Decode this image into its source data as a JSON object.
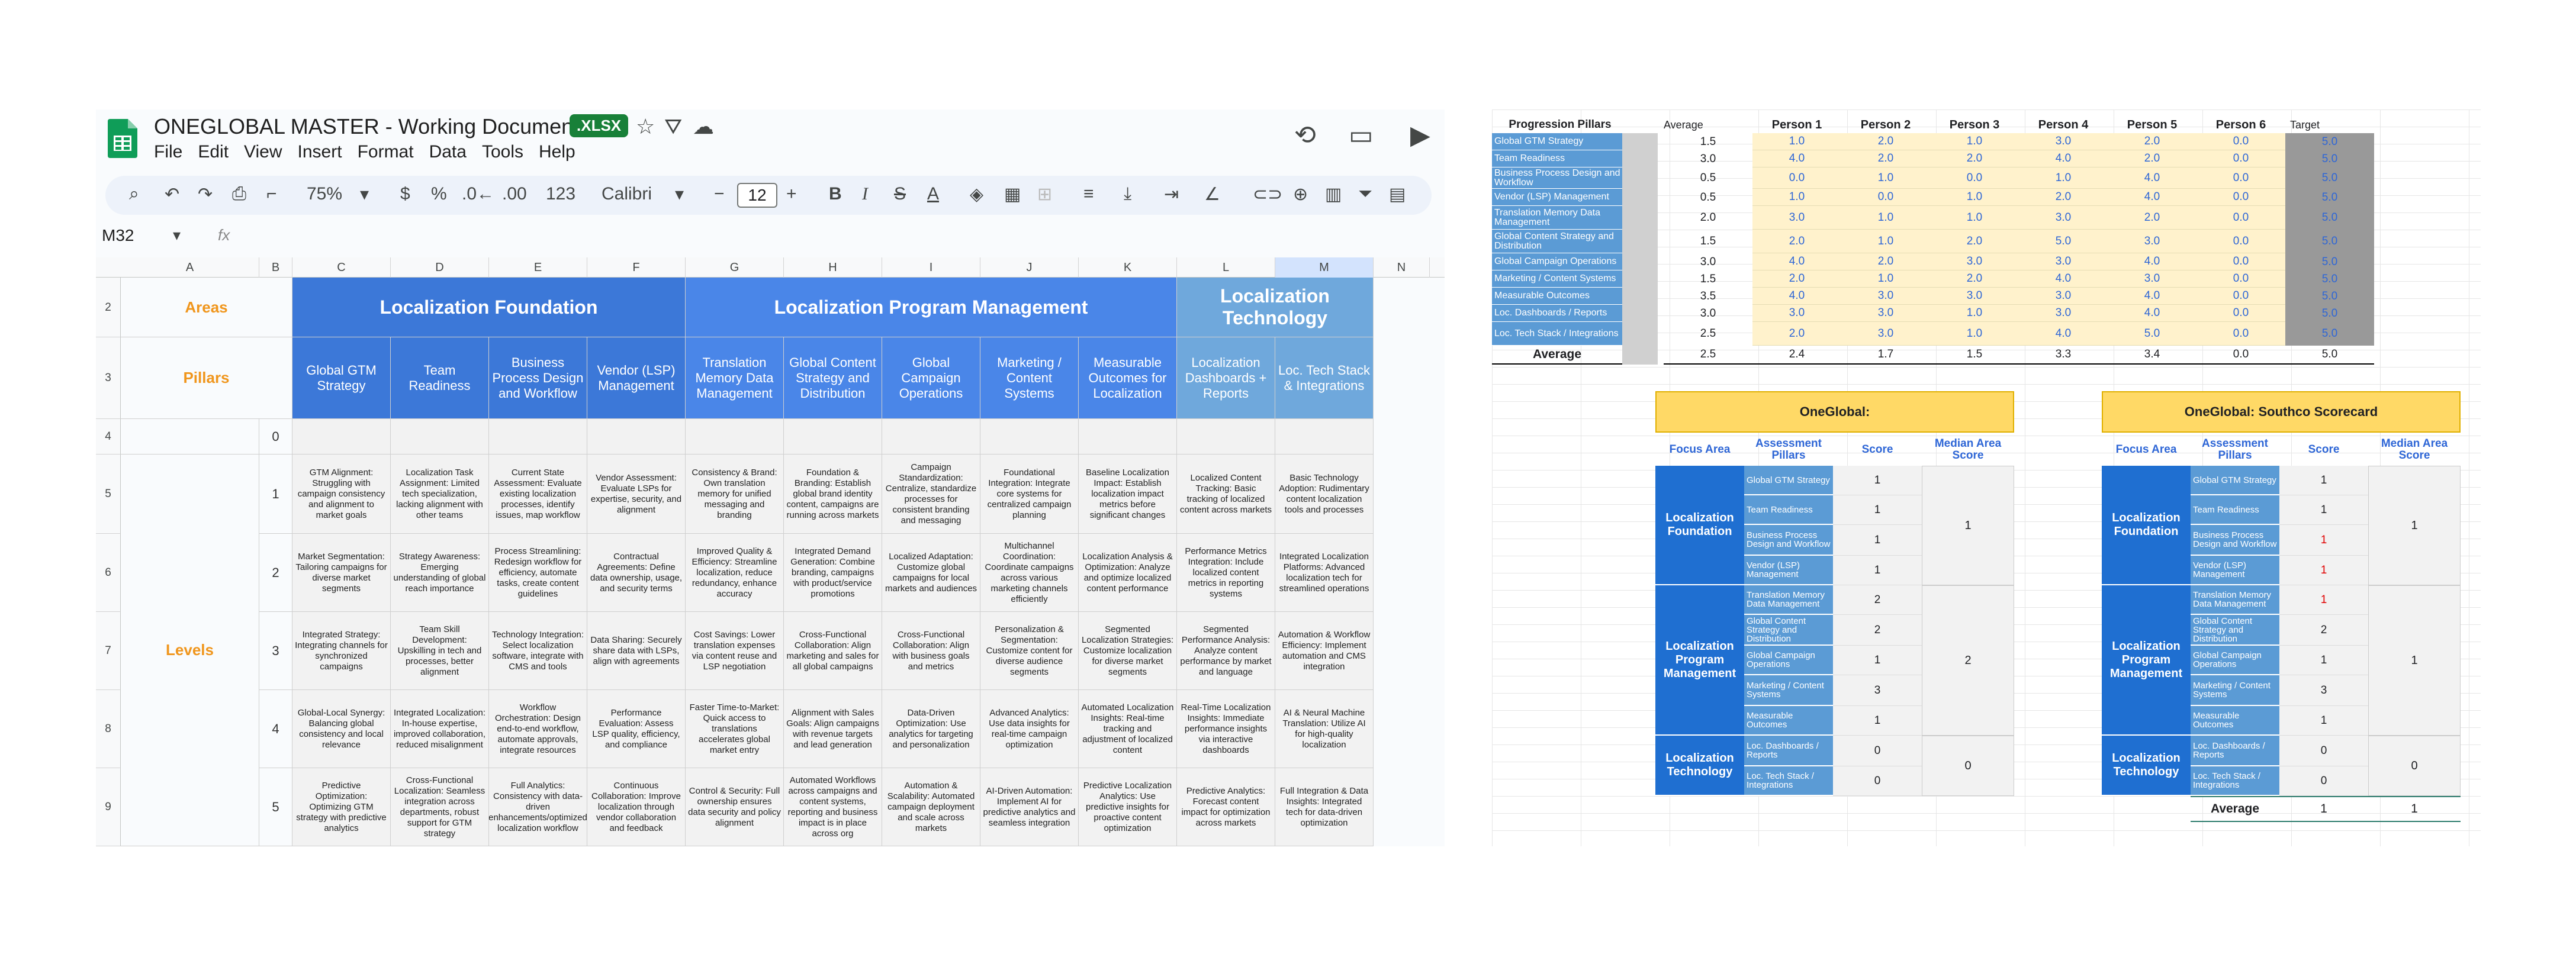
{
  "sheet": {
    "title": "ONEGLOBAL MASTER - Working Documents",
    "badge": ".XLSX",
    "menu": [
      "File",
      "Edit",
      "View",
      "Insert",
      "Format",
      "Data",
      "Tools",
      "Help"
    ],
    "zoom": "75%",
    "currency": "$",
    "percent": "%",
    "dec_less": ".0←",
    "dec_more": ".00",
    "num_fmt": "123",
    "font": "Calibri",
    "font_size": "12",
    "cell_ref": "M32",
    "fx": "fx",
    "columns": [
      "A",
      "B",
      "C",
      "D",
      "E",
      "F",
      "G",
      "H",
      "I",
      "J",
      "K",
      "L",
      "M",
      "N"
    ],
    "rows": [
      "2",
      "3",
      "4",
      "5",
      "6",
      "7",
      "8",
      "9"
    ],
    "areas_label": "Areas",
    "pillars_label": "Pillars",
    "levels_label": "Levels",
    "zero": "0",
    "groups": [
      "Localization Foundation",
      "Localization Program Management",
      "Localization Technology"
    ],
    "pillars": [
      "Global GTM Strategy",
      "Team Readiness",
      "Business Process Design and Workflow",
      "Vendor (LSP) Management",
      "Translation Memory Data Management",
      "Global Content Strategy and Distribution",
      "Global Campaign Operations",
      "Marketing / Content Systems",
      "Measurable Outcomes for Localization",
      "Localization Dashboards + Reports",
      "Loc. Tech Stack & Integrations"
    ],
    "levels": [
      {
        "n": "1",
        "cells": [
          "GTM Alignment: Struggling with campaign consistency and alignment to market goals",
          "Localization Task Assignment: Limited tech specialization, lacking alignment with other teams",
          "Current State Assessment: Evaluate existing localization processes, identify issues, map workflow",
          "Vendor Assessment: Evaluate LSPs for expertise, security, and alignment",
          "Consistency & Brand: Own translation memory for unified messaging and branding",
          "Foundation & Branding: Establish global brand identity content, campaigns are running across markets",
          "Campaign Standardization: Centralize, standardize processes for consistent branding and messaging",
          "Foundational Integration: Integrate core systems for centralized campaign planning",
          "Baseline Localization Impact: Establish localization impact metrics before significant changes",
          "Localized Content Tracking: Basic tracking of localized content across markets",
          "Basic Technology Adoption: Rudimentary content localization tools and processes"
        ]
      },
      {
        "n": "2",
        "cells": [
          "Market Segmentation: Tailoring campaigns for diverse market segments",
          "Strategy Awareness: Emerging understanding of global reach importance",
          "Process Streamlining: Redesign workflow for efficiency, automate tasks, create content guidelines",
          "Contractual Agreements: Define data ownership, usage, and security terms",
          "Improved Quality & Efficiency: Streamline localization, reduce redundancy, enhance accuracy",
          "Integrated Demand Generation: Combine branding, campaigns with product/service promotions",
          "Localized Adaptation: Customize global campaigns for local markets and audiences",
          "Multichannel Coordination: Coordinate campaigns across various marketing channels efficiently",
          "Localization Analysis & Optimization: Analyze and optimize localized content performance",
          "Performance Metrics Integration: Include localized content metrics in reporting systems",
          "Integrated Localization Platforms: Advanced localization tech for streamlined operations"
        ]
      },
      {
        "n": "3",
        "cells": [
          "Integrated Strategy: Integrating channels for synchronized campaigns",
          "Team Skill Development: Upskilling in tech and processes, better alignment",
          "Technology Integration: Select localization software, integrate with CMS and tools",
          "Data Sharing: Securely share data with LSPs, align with agreements",
          "Cost Savings: Lower translation expenses via content reuse and LSP negotiation",
          "Cross-Functional Collaboration: Align marketing and sales for all global campaigns",
          "Cross-Functional Collaboration: Align with business goals and metrics",
          "Personalization & Segmentation: Customize content for diverse audience segments",
          "Segmented Localization Strategies: Customize localization for diverse market segments",
          "Segmented Performance Analysis: Analyze content performance by market and language",
          "Automation & Workflow Efficiency: Implement automation and CMS integration"
        ]
      },
      {
        "n": "4",
        "cells": [
          "Global-Local Synergy: Balancing global consistency and local relevance",
          "Integrated Localization: In-house expertise, improved collaboration, reduced misalignment",
          "Workflow Orchestration: Design end-to-end workflow, automate approvals, integrate resources",
          "Performance Evaluation: Assess LSP quality, efficiency, and compliance",
          "Faster Time-to-Market: Quick access to translations accelerates global market entry",
          "Alignment with Sales Goals: Align campaigns with revenue targets and lead generation",
          "Data-Driven Optimization: Use analytics for targeting and personalization",
          "Advanced Analytics: Use data insights for real-time campaign optimization",
          "Automated Localization Insights: Real-time tracking and adjustment of localized content",
          "Real-Time Localization Insights: Immediate performance insights via interactive dashboards",
          "AI & Neural Machine Translation: Utilize AI for high-quality localization"
        ]
      },
      {
        "n": "5",
        "cells": [
          "Predictive Optimization: Optimizing GTM strategy with predictive analytics",
          "Cross-Functional Localization: Seamless integration across departments, robust support for GTM strategy",
          "Full Analytics: Consistency with data-driven enhancements/optimized localization workflow",
          "Continuous Collaboration: Improve localization through vendor collaboration and feedback",
          "Control & Security: Full ownership ensures data security and policy alignment",
          "Automated Workflows across campaigns and content systems, reporting and business impact is in place across org",
          "Automation & Scalability: Automated campaign deployment and scale across markets",
          "AI-Driven Automation: Implement AI for predictive analytics and seamless integration",
          "Predictive Localization Analytics: Use predictive insights for proactive content optimization",
          "Predictive Analytics: Forecast content impact for optimization across markets",
          "Full Integration & Data Insights: Integrated tech for data-driven optimization"
        ]
      }
    ]
  },
  "progress": {
    "header_pillars": "Progression Pillars",
    "header_average": "Average",
    "persons": [
      "Person 1",
      "Person 2",
      "Person 3",
      "Person 4",
      "Person 5",
      "Person 6"
    ],
    "target_label": "Target",
    "rows": [
      {
        "p": "Global GTM Strategy",
        "avg": "1.5",
        "v": [
          "1.0",
          "2.0",
          "1.0",
          "3.0",
          "2.0",
          "0.0"
        ],
        "t": "5.0"
      },
      {
        "p": "Team Readiness",
        "avg": "3.0",
        "v": [
          "4.0",
          "2.0",
          "2.0",
          "4.0",
          "2.0",
          "0.0"
        ],
        "t": "5.0"
      },
      {
        "p": "Business Process Design and Workflow",
        "avg": "0.5",
        "v": [
          "0.0",
          "1.0",
          "0.0",
          "1.0",
          "4.0",
          "0.0"
        ],
        "t": "5.0"
      },
      {
        "p": "Vendor (LSP) Management",
        "avg": "0.5",
        "v": [
          "1.0",
          "0.0",
          "1.0",
          "2.0",
          "4.0",
          "0.0"
        ],
        "t": "5.0"
      },
      {
        "p": "Translation Memory Data Management",
        "avg": "2.0",
        "v": [
          "3.0",
          "1.0",
          "1.0",
          "3.0",
          "2.0",
          "0.0"
        ],
        "t": "5.0"
      },
      {
        "p": "Global Content Strategy and Distribution",
        "avg": "1.5",
        "v": [
          "2.0",
          "1.0",
          "2.0",
          "5.0",
          "3.0",
          "0.0"
        ],
        "t": "5.0"
      },
      {
        "p": "Global Campaign Operations",
        "avg": "3.0",
        "v": [
          "4.0",
          "2.0",
          "3.0",
          "3.0",
          "4.0",
          "0.0"
        ],
        "t": "5.0"
      },
      {
        "p": "Marketing / Content Systems",
        "avg": "1.5",
        "v": [
          "2.0",
          "1.0",
          "2.0",
          "4.0",
          "3.0",
          "0.0"
        ],
        "t": "5.0"
      },
      {
        "p": "Measurable Outcomes",
        "avg": "3.5",
        "v": [
          "4.0",
          "3.0",
          "3.0",
          "3.0",
          "4.0",
          "0.0"
        ],
        "t": "5.0"
      },
      {
        "p": "Loc. Dashboards / Reports",
        "avg": "3.0",
        "v": [
          "3.0",
          "3.0",
          "1.0",
          "3.0",
          "4.0",
          "0.0"
        ],
        "t": "5.0"
      },
      {
        "p": "Loc. Tech Stack / Integrations",
        "avg": "2.5",
        "v": [
          "2.0",
          "3.0",
          "1.0",
          "4.0",
          "5.0",
          "0.0"
        ],
        "t": "5.0"
      }
    ],
    "average_label": "Average",
    "average_row": {
      "avg": "2.5",
      "v": [
        "2.4",
        "1.7",
        "1.5",
        "3.3",
        "3.4",
        "0.0"
      ],
      "t": "5.0"
    }
  },
  "scorecards": [
    {
      "title": "OneGlobal:",
      "h": [
        "Focus Area",
        "Assessment Pillars",
        "Score",
        "Median Area Score"
      ],
      "areas": [
        {
          "name": "Localization Foundation",
          "median": "1",
          "items": [
            [
              "Global GTM Strategy",
              "1"
            ],
            [
              "Team Readiness",
              "1"
            ],
            [
              "Business Process Design and Workflow",
              "1"
            ],
            [
              "Vendor (LSP) Management",
              "1"
            ]
          ]
        },
        {
          "name": "Localization Program Management",
          "median": "2",
          "items": [
            [
              "Translation Memory Data Management",
              "2"
            ],
            [
              "Global Content Strategy and Distribution",
              "2"
            ],
            [
              "Global Campaign Operations",
              "1"
            ],
            [
              "Marketing / Content Systems",
              "3"
            ],
            [
              "Measurable Outcomes",
              "1"
            ]
          ]
        },
        {
          "name": "Localization Technology",
          "median": "0",
          "items": [
            [
              "Loc. Dashboards / Reports",
              "0"
            ],
            [
              "Loc. Tech Stack / Integrations",
              "0"
            ]
          ]
        }
      ]
    },
    {
      "title": "OneGlobal: Southco Scorecard",
      "h": [
        "Focus Area",
        "Assessment Pillars",
        "Score",
        "Median Area Score"
      ],
      "areas": [
        {
          "name": "Localization Foundation",
          "median": "1",
          "items": [
            [
              "Global GTM Strategy",
              "1"
            ],
            [
              "Team Readiness",
              "1"
            ],
            [
              "Business Process Design and Workflow",
              "1"
            ],
            [
              "Vendor (LSP) Management",
              "1"
            ]
          ]
        },
        {
          "name": "Localization Program Management",
          "median": "1",
          "items": [
            [
              "Translation Memory Data Management",
              "1"
            ],
            [
              "Global Content Strategy and Distribution",
              "2"
            ],
            [
              "Global Campaign Operations",
              "1"
            ],
            [
              "Marketing / Content Systems",
              "3"
            ],
            [
              "Measurable Outcomes",
              "1"
            ]
          ]
        },
        {
          "name": "Localization Technology",
          "median": "0",
          "items": [
            [
              "Loc. Dashboards / Reports",
              "0"
            ],
            [
              "Loc. Tech Stack / Integrations",
              "0"
            ]
          ]
        }
      ],
      "average_label": "Average",
      "average_score": "1",
      "average_median": "1"
    }
  ],
  "colors": {
    "group1": "#3c78d8",
    "group2": "#4a86e8",
    "group3": "#6fa8dc",
    "pillar": "#5b9bd5",
    "accent_orange": "#f0961d",
    "yellow_header": "#ffd966",
    "focus_blue": "#1f6fd1",
    "sheets_green": "#0f9d58"
  }
}
